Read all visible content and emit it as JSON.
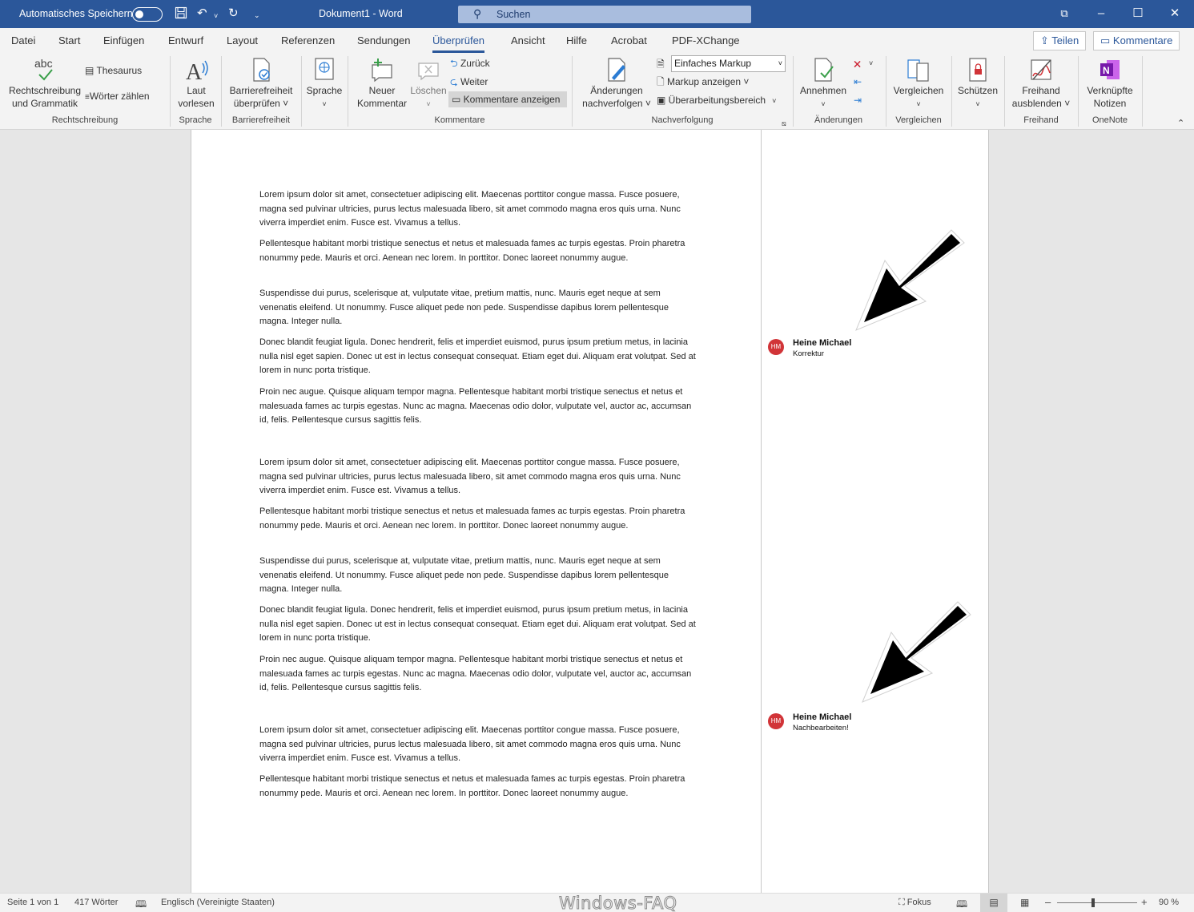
{
  "titlebar": {
    "autosave_label": "Automatisches Speichern",
    "doc_title": "Dokument1  -  Word",
    "search_placeholder": "Suchen",
    "colors": {
      "title_bg": "#2b579a",
      "search_bg": "#a9bdde"
    }
  },
  "tabs": [
    "Datei",
    "Start",
    "Einfügen",
    "Entwurf",
    "Layout",
    "Referenzen",
    "Sendungen",
    "Überprüfen",
    "Ansicht",
    "Hilfe",
    "Acrobat",
    "PDF-XChange"
  ],
  "active_tab": "Überprüfen",
  "share": {
    "share_label": "Teilen",
    "comments_label": "Kommentare"
  },
  "ribbon": {
    "spelling": {
      "l1": "Rechtschreibung",
      "l2": "und Grammatik",
      "icon_text": "abc"
    },
    "thesaurus": "Thesaurus",
    "wordcount": "Wörter zählen",
    "readaloud": {
      "l1": "Laut",
      "l2": "vorlesen"
    },
    "accessibility": {
      "l1": "Barrierefreiheit",
      "l2": "überprüfen ˅"
    },
    "language": "Sprache",
    "newcomment": {
      "l1": "Neuer",
      "l2": "Kommentar"
    },
    "delete": "Löschen",
    "previous": "Zurück",
    "next": "Weiter",
    "showcomments": "Kommentare anzeigen",
    "trackchanges": {
      "l1": "Änderungen",
      "l2": "nachverfolgen ˅"
    },
    "markup_select": "Einfaches Markup",
    "showmarkup": "Markup anzeigen ˅",
    "reviewpane": "Überarbeitungsbereich",
    "accept": "Annehmen",
    "compare": "Vergleichen",
    "protect": "Schützen",
    "ink": {
      "l1": "Freihand",
      "l2": "ausblenden ˅"
    },
    "onenote": {
      "l1": "Verknüpfte",
      "l2": "Notizen"
    },
    "groups": {
      "spelling": "Rechtschreibung",
      "language": "Sprache",
      "accessibility": "Barrierefreiheit",
      "comments": "Kommentare",
      "tracking": "Nachverfolgung",
      "changes": "Änderungen",
      "compare": "Vergleichen",
      "ink": "Freihand",
      "onenote": "OneNote"
    }
  },
  "document": {
    "paragraphs": [
      "Lorem ipsum dolor sit amet, consectetuer adipiscing elit. Maecenas porttitor congue massa. Fusce posuere, magna sed pulvinar ultricies, purus lectus malesuada libero, sit amet commodo magna eros quis urna. Nunc viverra imperdiet enim. Fusce est. Vivamus a tellus.",
      "Pellentesque habitant morbi tristique senectus et netus et malesuada fames ac turpis egestas. Proin pharetra nonummy pede. Mauris et orci. Aenean nec lorem. In porttitor. Donec laoreet nonummy augue.",
      "Suspendisse dui purus, scelerisque at, vulputate vitae, pretium mattis, nunc. Mauris eget neque at sem venenatis eleifend. Ut nonummy. Fusce aliquet pede non pede. Suspendisse dapibus lorem pellentesque magna. Integer nulla.",
      "Donec blandit feugiat ligula. Donec hendrerit, felis et imperdiet euismod, purus ipsum pretium metus, in lacinia nulla nisl eget sapien. Donec ut est in lectus consequat consequat. Etiam eget dui. Aliquam erat volutpat. Sed at lorem in nunc porta tristique.",
      "Proin nec augue. Quisque aliquam tempor magna. Pellentesque habitant morbi tristique senectus et netus et malesuada fames ac turpis egestas. Nunc ac magna. Maecenas odio dolor, vulputate vel, auctor ac, accumsan id, felis. Pellentesque cursus sagittis felis."
    ],
    "comments": [
      {
        "initials": "HM",
        "author": "Heine Michael",
        "text": "Korrektur"
      },
      {
        "initials": "HM",
        "author": "Heine Michael",
        "text": "Nachbearbeiten!"
      }
    ]
  },
  "status": {
    "page": "Seite 1 von 1",
    "words": "417 Wörter",
    "language": "Englisch (Vereinigte Staaten)",
    "focus": "Fokus",
    "zoom": "90 %",
    "zoom_level": 0.9
  },
  "watermark": "Windows-FAQ"
}
